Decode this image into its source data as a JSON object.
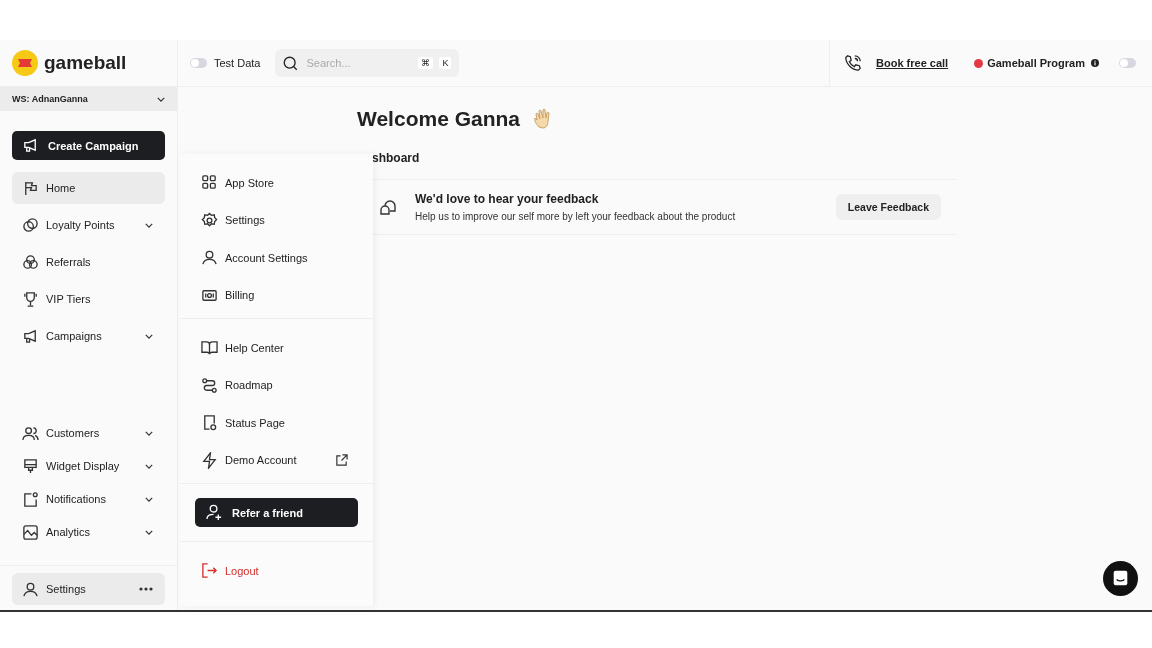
{
  "header": {
    "logo": "gameball",
    "test_data": {
      "label": "Test Data",
      "on": false
    },
    "search": {
      "placeholder": "Search...",
      "shortcut": [
        "⌘",
        "K"
      ]
    },
    "book_call": "Book free call",
    "program": {
      "label": "Gameball Program",
      "on": false
    }
  },
  "sidebar": {
    "workspace": "WS: AdnanGanna",
    "create_button": "Create Campaign",
    "items": [
      {
        "label": "Home",
        "selected": true,
        "expandable": false
      },
      {
        "label": "Loyalty Points",
        "selected": false,
        "expandable": true
      },
      {
        "label": "Referrals",
        "selected": false,
        "expandable": false
      },
      {
        "label": "VIP Tiers",
        "selected": false,
        "expandable": false
      },
      {
        "label": "Campaigns",
        "selected": false,
        "expandable": true
      }
    ],
    "bottom_items": [
      {
        "label": "Customers",
        "selected": false,
        "expandable": true
      },
      {
        "label": "Widget Display",
        "selected": false,
        "expandable": true
      },
      {
        "label": "Notifications",
        "selected": false,
        "expandable": true
      },
      {
        "label": "Analytics",
        "selected": false,
        "expandable": true
      }
    ],
    "settings": {
      "label": "Settings",
      "selected": true
    }
  },
  "main": {
    "title": "Welcome Ganna",
    "section": "shboard",
    "feedback": {
      "title": "We'd love to hear your feedback",
      "text": "Help us to improve our self more by left your feedback about the product",
      "button": "Leave Feedback"
    }
  },
  "menu": {
    "groups": [
      [
        {
          "label": "App Store",
          "external": false
        },
        {
          "label": "Settings",
          "external": false
        },
        {
          "label": "Account Settings",
          "external": false
        },
        {
          "label": "Billing",
          "external": false
        }
      ],
      [
        {
          "label": "Help Center",
          "external": false
        },
        {
          "label": "Roadmap",
          "external": false
        },
        {
          "label": "Status Page",
          "external": false
        },
        {
          "label": "Demo Account",
          "external": true
        }
      ]
    ],
    "refer_button": "Refer a friend",
    "logout": "Logout"
  }
}
